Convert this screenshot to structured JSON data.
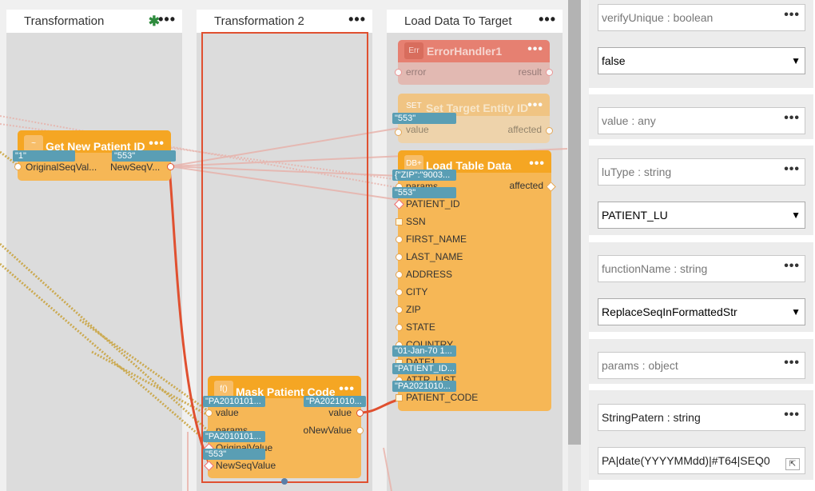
{
  "lanes": [
    {
      "title": "Transformation",
      "has_star": true
    },
    {
      "title": "Transformation 2"
    },
    {
      "title": "Load Data To Target"
    }
  ],
  "nodes": {
    "error_handler": {
      "icon": "Err",
      "title": "ErrorHandler1",
      "ports": {
        "left": "error",
        "right": "result"
      }
    },
    "set_target": {
      "icon": "SET",
      "title": "Set Target Entity ID",
      "ports": {
        "left": "value",
        "right": "affected"
      },
      "tag": "\"553\""
    },
    "get_new_patient": {
      "icon": "~",
      "title": "Get New Patient ID",
      "ports": {
        "left": "OriginalSeqVal...",
        "right": "NewSeqV..."
      },
      "tags": {
        "left": "\"1\"",
        "right": "\"553\""
      }
    },
    "load_table": {
      "icon": "DB+",
      "title": "Load Table Data",
      "ports": [
        "params",
        "PATIENT_ID",
        "SSN",
        "FIRST_NAME",
        "LAST_NAME",
        "ADDRESS",
        "CITY",
        "ZIP",
        "STATE",
        "COUNTRY",
        "DATE1",
        "ATTR_LIST",
        "PATIENT_CODE"
      ],
      "right_port": "affected",
      "tags": {
        "params": "{\"ZIP\":\"9003...",
        "patient_id": "\"553\"",
        "date1": "\"01-Jan-70 1...",
        "attr_list": "\"PATIENT_ID...",
        "patient_code": "\"PA2021010..."
      }
    },
    "mask_patient": {
      "icon": "f()",
      "title": "Mask Patient Code",
      "ports": {
        "value": "value",
        "params": "params",
        "original": "OriginalValue",
        "newseq": "NewSeqValue",
        "out_value": "value",
        "out_new": "oNewValue"
      },
      "tags": {
        "value": "\"PA2010101...",
        "out": "\"PA2021010...",
        "original": "\"PA2010101...",
        "newseq": "\"553\""
      }
    }
  },
  "panel": {
    "sections": [
      {
        "label": "verifyUnique : boolean",
        "select": "false"
      },
      {
        "label": "value : any"
      },
      {
        "label": "luType : string",
        "select": "PATIENT_LU"
      },
      {
        "label": "functionName : string",
        "select": "ReplaceSeqInFormattedStr"
      },
      {
        "label": "params : object"
      },
      {
        "label": "StringPatern : string",
        "text": "PA|date(YYYYMMdd)|#T64|SEQ0"
      }
    ]
  },
  "icons": {
    "more": "more-icon",
    "star": "star-icon",
    "chevron": "chevron-down-icon",
    "expand": "expand-icon"
  },
  "colors": {
    "node": "#f6b756",
    "node_header": "#f5a623",
    "error": "#e8705f",
    "selection": "#e05030",
    "tag": "#5a9eb4"
  }
}
